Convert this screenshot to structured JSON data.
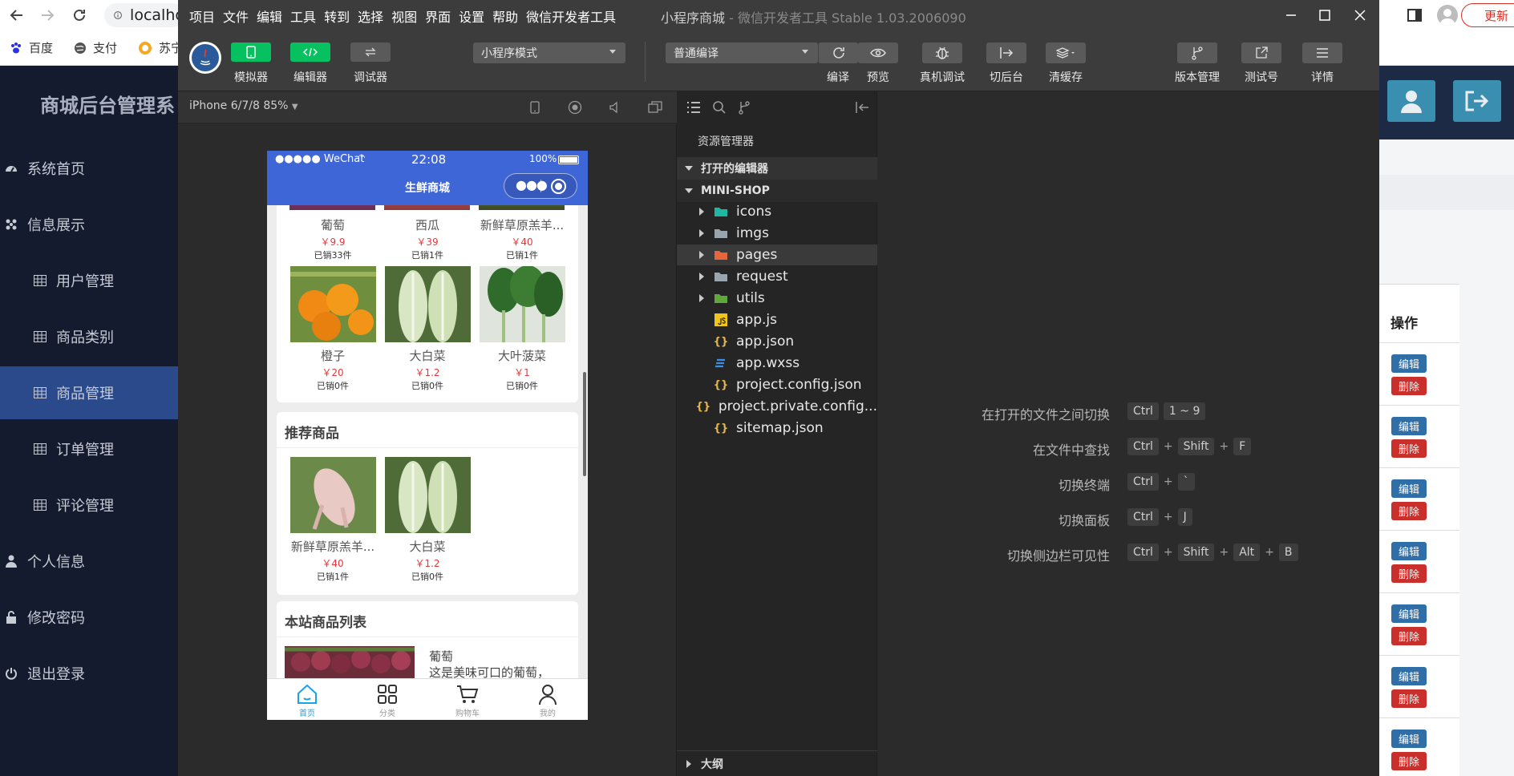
{
  "browser": {
    "url": "localho",
    "update_label": "更新",
    "bookmarks": [
      "百度",
      "支付",
      "苏宁"
    ]
  },
  "admin": {
    "brand": "商城后台管理系",
    "menu": [
      {
        "label": "系统首页",
        "icon": "dashboard-icon",
        "level": 0
      },
      {
        "label": "信息展示",
        "icon": "cluster-icon",
        "level": 0
      },
      {
        "label": "用户管理",
        "icon": "table-icon",
        "level": 1
      },
      {
        "label": "商品类别",
        "icon": "table-icon",
        "level": 1
      },
      {
        "label": "商品管理",
        "icon": "table-icon",
        "level": 1,
        "active": true
      },
      {
        "label": "订单管理",
        "icon": "table-icon",
        "level": 1
      },
      {
        "label": "评论管理",
        "icon": "table-icon",
        "level": 1
      },
      {
        "label": "个人信息",
        "icon": "user-icon",
        "level": 0
      },
      {
        "label": "修改密码",
        "icon": "lock-icon",
        "level": 0
      },
      {
        "label": "退出登录",
        "icon": "power-icon",
        "level": 0
      }
    ],
    "ops_header": "操作",
    "edit_label": "编辑",
    "delete_label": "删除"
  },
  "devtools": {
    "menu": [
      "项目",
      "文件",
      "编辑",
      "工具",
      "转到",
      "选择",
      "视图",
      "界面",
      "设置",
      "帮助",
      "微信开发者工具"
    ],
    "title": "小程序商城",
    "title_sub": "- 微信开发者工具 Stable 1.03.2006090",
    "toolbar": {
      "simulator": "模拟器",
      "editor": "编辑器",
      "debugger": "调试器",
      "mode": "小程序模式",
      "compile_mode": "普通编译",
      "compile": "编译",
      "preview": "预览",
      "remote_debug": "真机调试",
      "background": "切后台",
      "clear_cache": "清缓存",
      "version": "版本管理",
      "test_account": "测试号",
      "details": "详情"
    },
    "device": "iPhone 6/7/8 85%",
    "explorer": {
      "title": "资源管理器",
      "open_editors": "打开的编辑器",
      "project": "MINI-SHOP",
      "outline": "大纲",
      "files": [
        {
          "name": "icons",
          "type": "folder",
          "color": "#1fb6a4"
        },
        {
          "name": "imgs",
          "type": "folder",
          "color": "#9aa4ad"
        },
        {
          "name": "pages",
          "type": "folder",
          "color": "#e8643a"
        },
        {
          "name": "request",
          "type": "folder",
          "color": "#9aa4ad"
        },
        {
          "name": "utils",
          "type": "folder",
          "color": "#5ea93a"
        },
        {
          "name": "app.js",
          "type": "js"
        },
        {
          "name": "app.json",
          "type": "json"
        },
        {
          "name": "app.wxss",
          "type": "css"
        },
        {
          "name": "project.config.json",
          "type": "json"
        },
        {
          "name": "project.private.config...",
          "type": "json"
        },
        {
          "name": "sitemap.json",
          "type": "json"
        }
      ]
    },
    "shortcuts": [
      {
        "label": "在打开的文件之间切换",
        "keys": [
          "Ctrl",
          "1 ~ 9"
        ]
      },
      {
        "label": "在文件中查找",
        "keys": [
          "Ctrl",
          "+",
          "Shift",
          "+",
          "F"
        ]
      },
      {
        "label": "切换终端",
        "keys": [
          "Ctrl",
          "+",
          "`"
        ]
      },
      {
        "label": "切换面板",
        "keys": [
          "Ctrl",
          "+",
          "J"
        ]
      },
      {
        "label": "切换侧边栏可见性",
        "keys": [
          "Ctrl",
          "+",
          "Shift",
          "+",
          "Alt",
          "+",
          "B"
        ]
      }
    ]
  },
  "phone": {
    "carrier": "●●●●● WeChat",
    "time": "22:08",
    "battery": "100%",
    "nav_title": "生鲜商城",
    "row1": [
      {
        "name": "葡萄",
        "price": "￥9.9",
        "sold": "已销33件"
      },
      {
        "name": "西瓜",
        "price": "￥39",
        "sold": "已销1件"
      },
      {
        "name": "新鲜草原羔羊...",
        "price": "￥40",
        "sold": "已销1件"
      }
    ],
    "row2": [
      {
        "name": "橙子",
        "price": "￥20",
        "sold": "已销0件"
      },
      {
        "name": "大白菜",
        "price": "￥1.2",
        "sold": "已销0件"
      },
      {
        "name": "大叶菠菜",
        "price": "￥1",
        "sold": "已销0件"
      }
    ],
    "recommend_title": "推荐商品",
    "recommend": [
      {
        "name": "新鲜草原羔羊...",
        "price": "￥40",
        "sold": "已销1件"
      },
      {
        "name": "大白菜",
        "price": "￥1.2",
        "sold": "已销0件"
      }
    ],
    "list_title": "本站商品列表",
    "list_item": {
      "name": "葡萄",
      "desc": "这是美味可口的葡萄，"
    },
    "tabs": [
      "首页",
      "分类",
      "购物车",
      "我的"
    ]
  }
}
